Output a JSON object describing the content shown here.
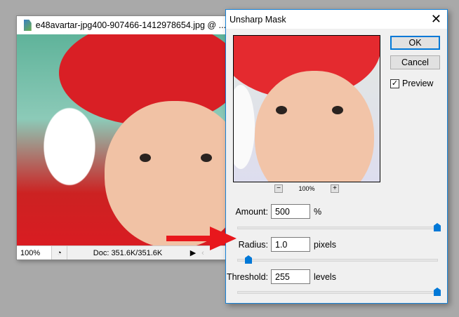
{
  "document_window": {
    "title": "e48avartar-jpg400-907466-1412978654.jpg @ ...",
    "zoom": "100%",
    "doc_info": "Doc: 351.6K/351.6K"
  },
  "dialog": {
    "title": "Unsharp Mask",
    "ok": "OK",
    "cancel": "Cancel",
    "preview_label": "Preview",
    "preview_checked": true,
    "preview_zoom": "100%",
    "zoom_out": "−",
    "zoom_in": "+",
    "amount": {
      "label": "Amount:",
      "value": "500",
      "unit": "%",
      "slider_fraction": 1.0
    },
    "radius": {
      "label": "Radius:",
      "value": "1.0",
      "unit": "pixels",
      "slider_fraction": 0.0
    },
    "threshold": {
      "label": "Threshold:",
      "value": "255",
      "unit": "levels",
      "slider_fraction": 1.0
    }
  },
  "colors": {
    "accent": "#0078d7",
    "arrow": "#e8171c"
  }
}
